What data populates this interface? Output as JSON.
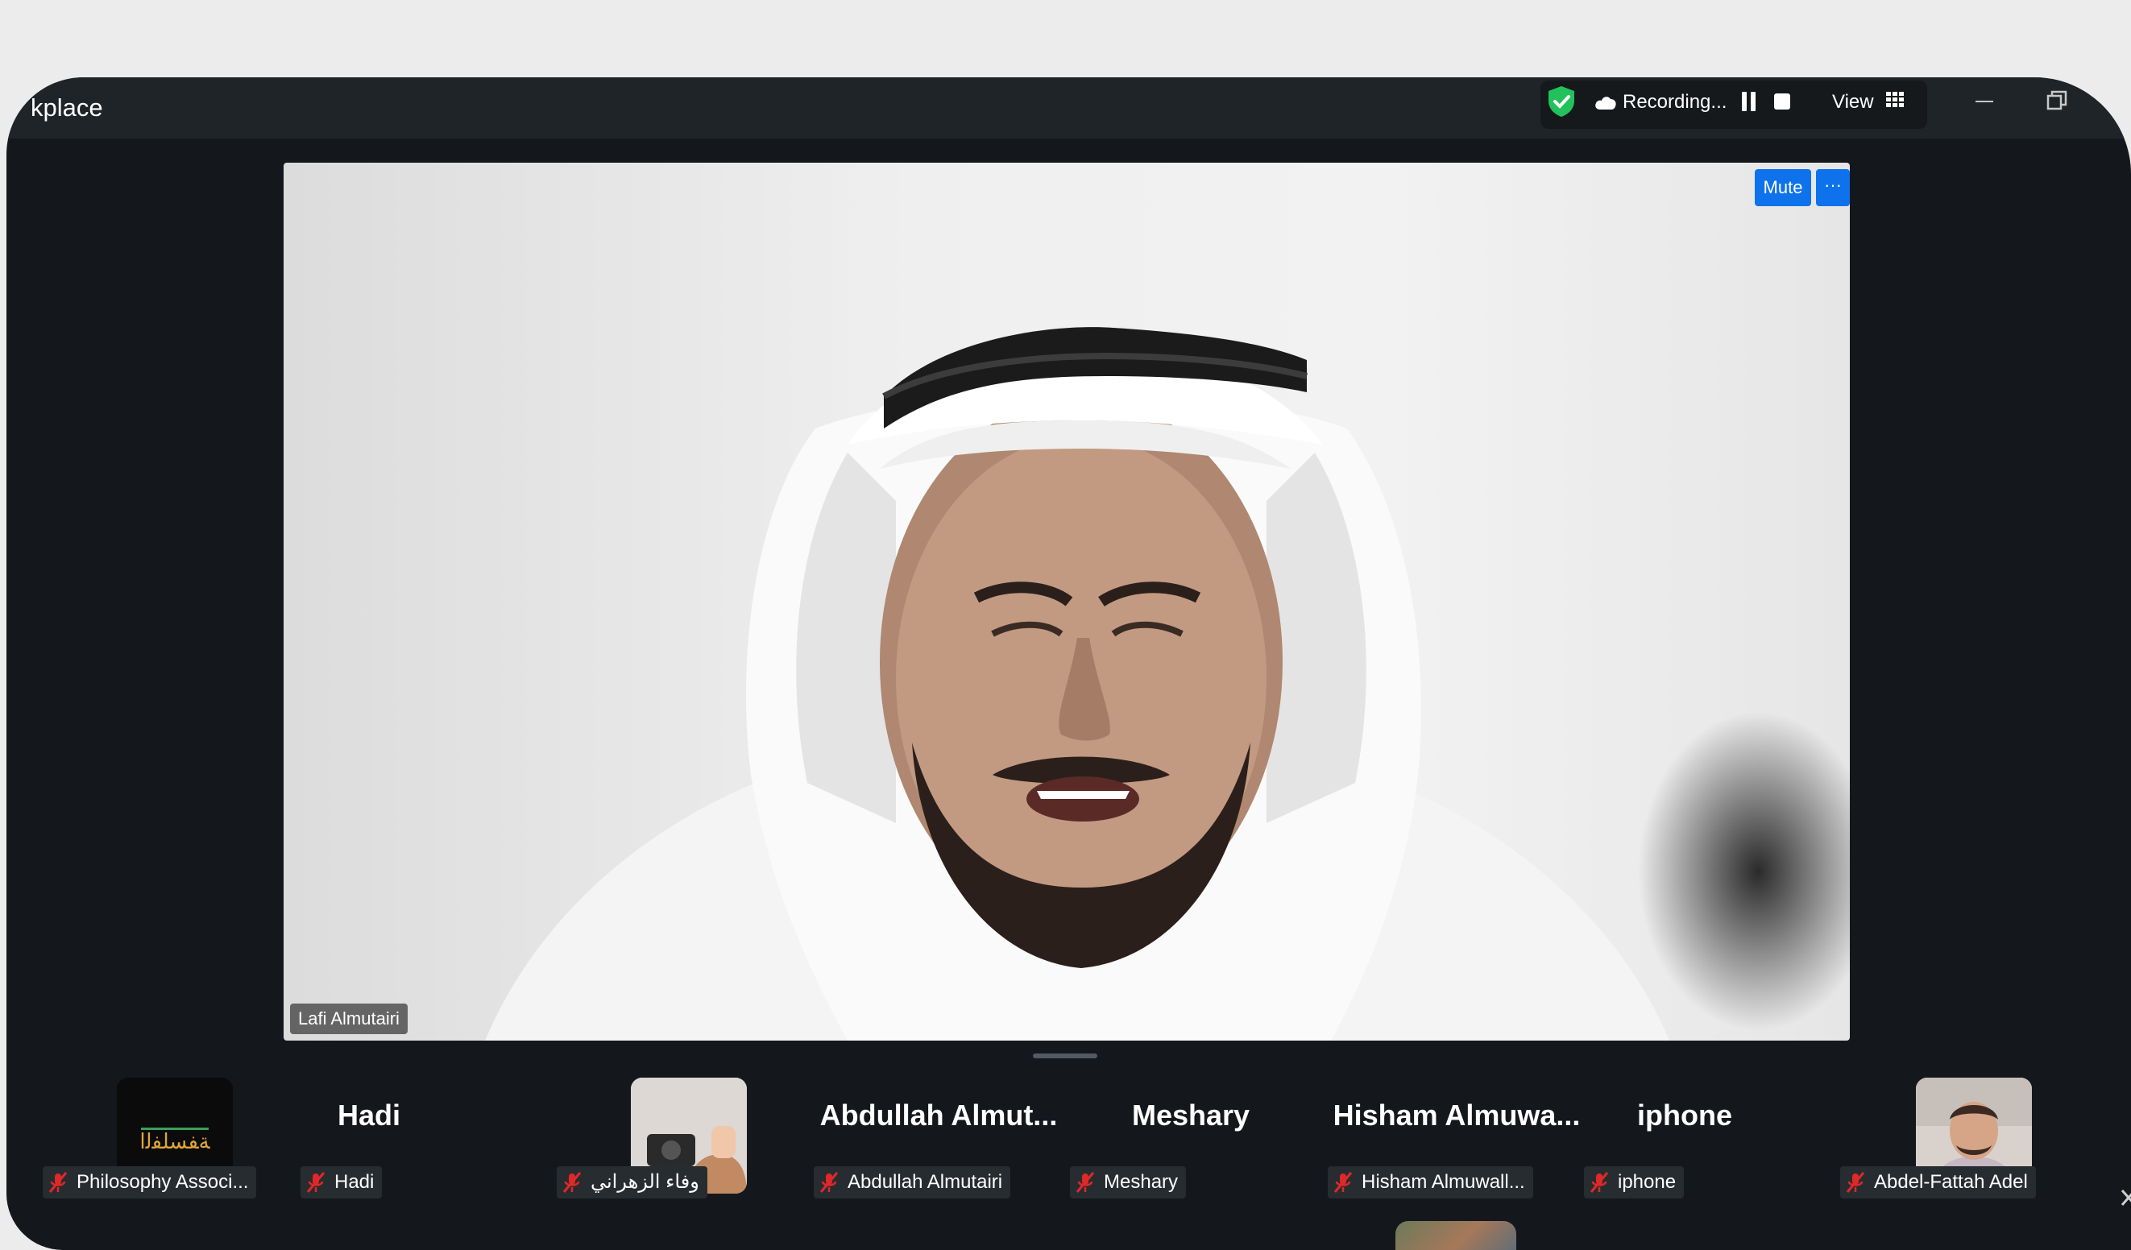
{
  "window": {
    "title": "kplace"
  },
  "recording": {
    "status_text": "Recording...",
    "view_label": "View",
    "shield_color": "#23c15b"
  },
  "speaker": {
    "name": "Lafi Almutairi",
    "mute_label": "Mute",
    "more_label": "···"
  },
  "participants": [
    {
      "big_name": "",
      "label": "Philosophy Associ...",
      "has_thumbnail": true,
      "thumbnail": "logo"
    },
    {
      "big_name": "Hadi",
      "label": "Hadi",
      "has_thumbnail": false
    },
    {
      "big_name": "",
      "label": "وفاء الزهراني",
      "has_thumbnail": true,
      "thumbnail": "photo"
    },
    {
      "big_name": "Abdullah  Almut...",
      "label": "Abdullah Almutairi",
      "has_thumbnail": false
    },
    {
      "big_name": "Meshary",
      "label": "Meshary",
      "has_thumbnail": false
    },
    {
      "big_name": "Hisham  Almuwa...",
      "label": "Hisham Almuwall...",
      "has_thumbnail": false
    },
    {
      "big_name": "iphone",
      "label": "iphone",
      "has_thumbnail": false
    },
    {
      "big_name": "",
      "label": "Abdel-Fattah Adel",
      "has_thumbnail": true,
      "thumbnail": "photo"
    }
  ],
  "colors": {
    "window_bg": "#14181d",
    "titlebar_bg": "#1f2428",
    "accent": "#0e72ed",
    "mic_off": "#e02828"
  }
}
